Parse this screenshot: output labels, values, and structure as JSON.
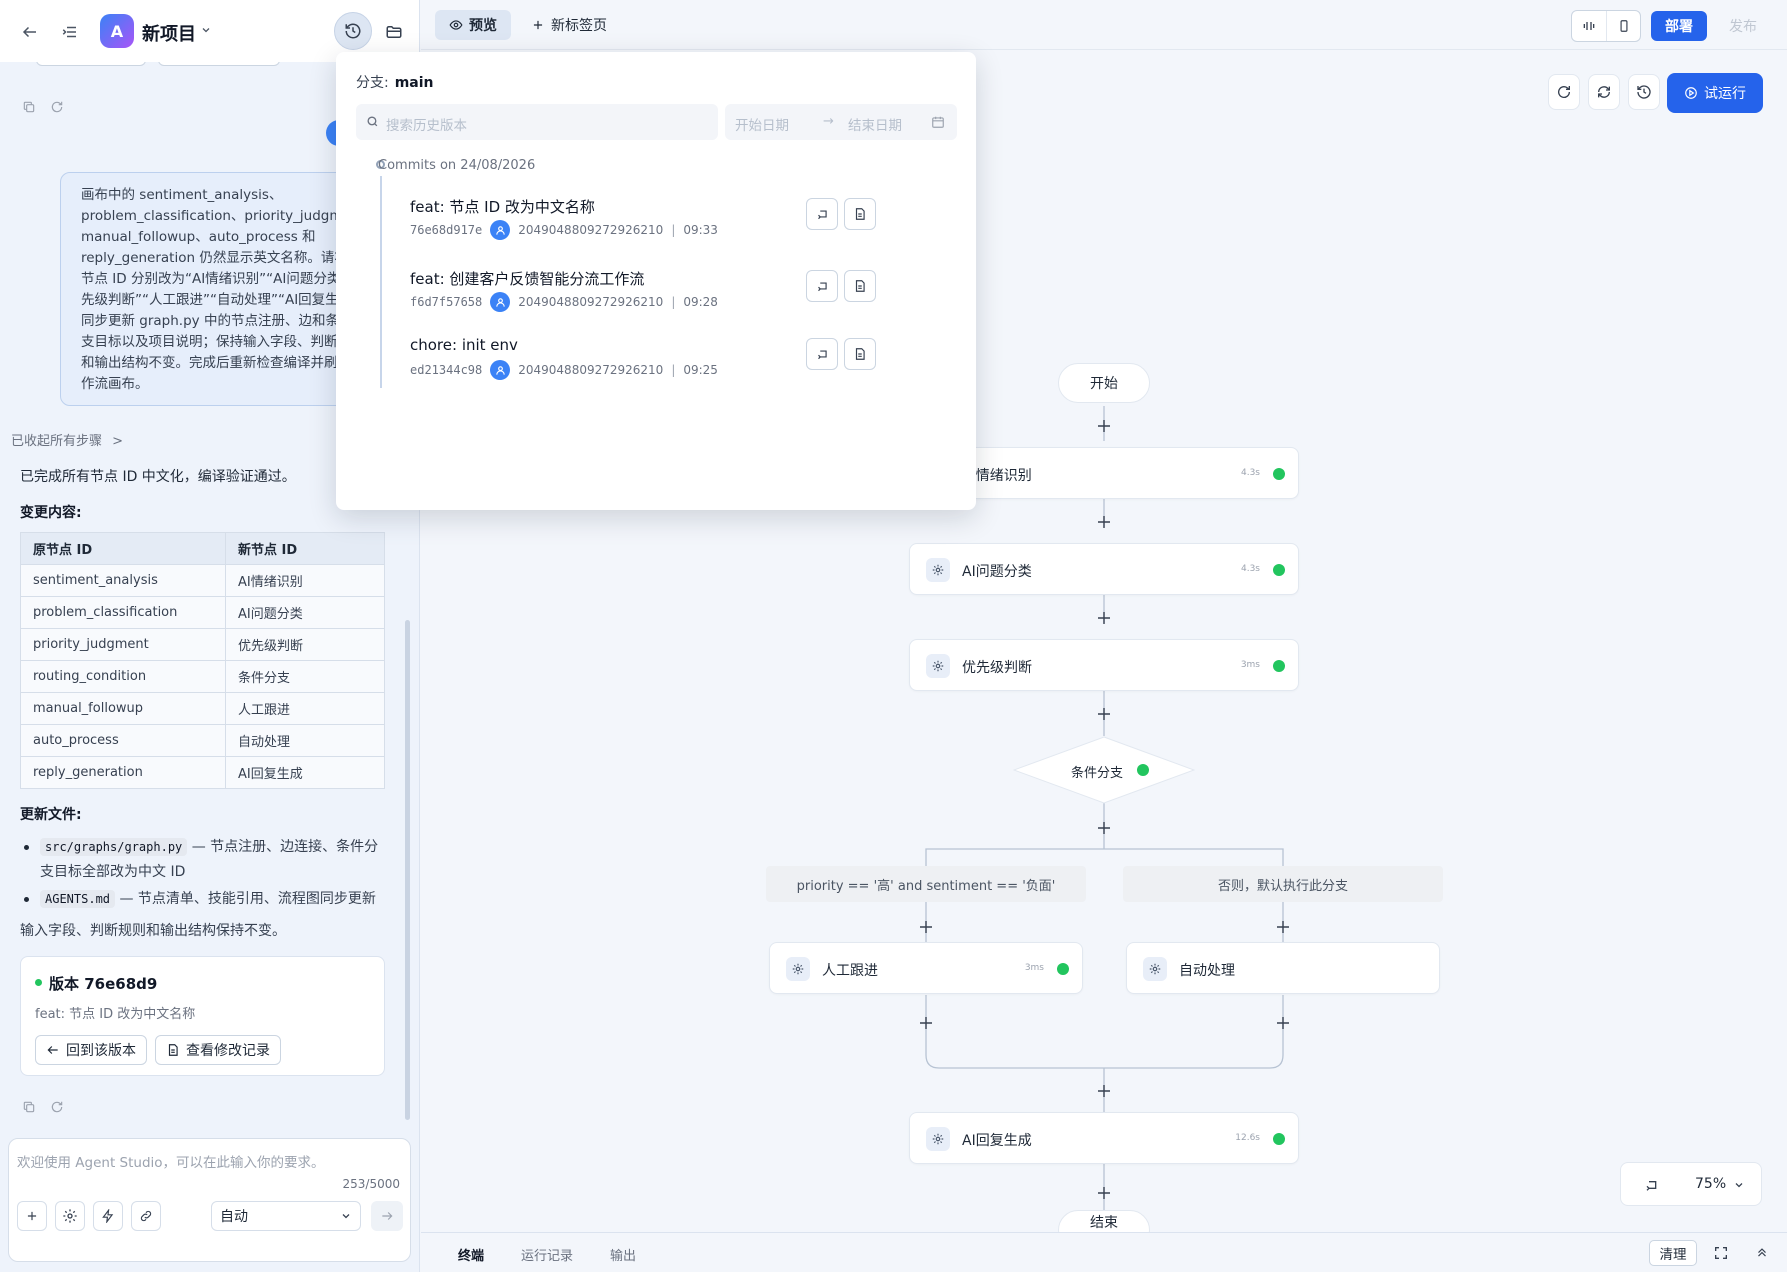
{
  "project": {
    "logo_letter": "A",
    "name": "新项目"
  },
  "chat": {
    "user_message_lines": [
      "画布中的 sentiment_analysis、",
      "problem_classification、priority_judgment、",
      "manual_followup、auto_process 和",
      "reply_generation 仍然显示英文名称。请将",
      "节点 ID 分别改为“AI情绪识别”“AI问题分类”“优",
      "先级判断”“人工跟进”“自动处理”“AI回复生成”，",
      "同步更新 graph.py 中的节点注册、边和条件分",
      "支目标以及项目说明；保持输入字段、判断规则",
      "和输出结构不变。完成后重新检查编译并刷新工",
      "作流画布。"
    ],
    "collapsed_steps": "已收起所有步骤",
    "done_text": "已完成所有节点 ID 中文化，编译验证通过。",
    "changes_title": "变更内容:",
    "table": {
      "headers": [
        "原节点 ID",
        "新节点 ID"
      ],
      "rows": [
        [
          "sentiment_analysis",
          "AI情绪识别"
        ],
        [
          "problem_classification",
          "AI问题分类"
        ],
        [
          "priority_judgment",
          "优先级判断"
        ],
        [
          "routing_condition",
          "条件分支"
        ],
        [
          "manual_followup",
          "人工跟进"
        ],
        [
          "auto_process",
          "自动处理"
        ],
        [
          "reply_generation",
          "AI回复生成"
        ]
      ]
    },
    "files_title": "更新文件:",
    "files": [
      {
        "code": "src/graphs/graph.py",
        "desc_1": " — 节点注册、边连接、条件分",
        "desc_2": "支目标全部改为中文 ID"
      },
      {
        "code": "AGENTS.md",
        "desc_1": " — 节点清单、技能引用、流程图同步更新",
        "desc_2": ""
      }
    ],
    "files_note": "输入字段、判断规则和输出结构保持不变。",
    "version_card": {
      "title": "版本 76e68d9",
      "message": "feat: 节点 ID 改为中文名称",
      "revert_label": "回到该版本",
      "changes_label": "查看修改记录"
    }
  },
  "input": {
    "placeholder": "欢迎使用 Agent Studio，可以在此输入你的要求。",
    "char_count": "253/5000",
    "mode": "自动"
  },
  "topbar": {
    "tab_preview": "预览",
    "tab_new": "新标签页",
    "deploy": "部署",
    "publish": "发布"
  },
  "canvas": {
    "trial_run": "试运行",
    "zoom": "75%",
    "nodes": {
      "start": "开始",
      "n1": {
        "label": "AI情绪识别",
        "time": "4.3s"
      },
      "n2": {
        "label": "AI问题分类",
        "time": "4.3s"
      },
      "n3": {
        "label": "优先级判断",
        "time": "3ms"
      },
      "cond": "条件分支",
      "branch_a": "priority == '高' and sentiment == '负面'",
      "branch_b": "否则，默认执行此分支",
      "n4": {
        "label": "人工跟进",
        "time": "3ms"
      },
      "n5": {
        "label": "自动处理"
      },
      "n6": {
        "label": "AI回复生成",
        "time": "12.6s"
      },
      "end": "结束"
    }
  },
  "bottom": {
    "tab_terminal": "终端",
    "tab_runs": "运行记录",
    "tab_output": "输出",
    "clear": "清理"
  },
  "history": {
    "branch_label": "分支:",
    "branch": "main",
    "search_placeholder": "搜索历史版本",
    "date_start": "开始日期",
    "date_end": "结束日期",
    "group": "Commits on 24/08/2026",
    "commits": [
      {
        "title": "feat: 节点 ID 改为中文名称",
        "hash": "76e68d917e",
        "user": "2049048809272926210",
        "time": "09:33"
      },
      {
        "title": "feat: 创建客户反馈智能分流工作流",
        "hash": "f6d7f57658",
        "user": "2049048809272926210",
        "time": "09:28"
      },
      {
        "title": "chore: init env",
        "hash": "ed21344c98",
        "user": "2049048809272926210",
        "time": "09:25"
      }
    ]
  },
  "colors": {
    "accent": "#2563eb",
    "success": "#22c55e"
  }
}
